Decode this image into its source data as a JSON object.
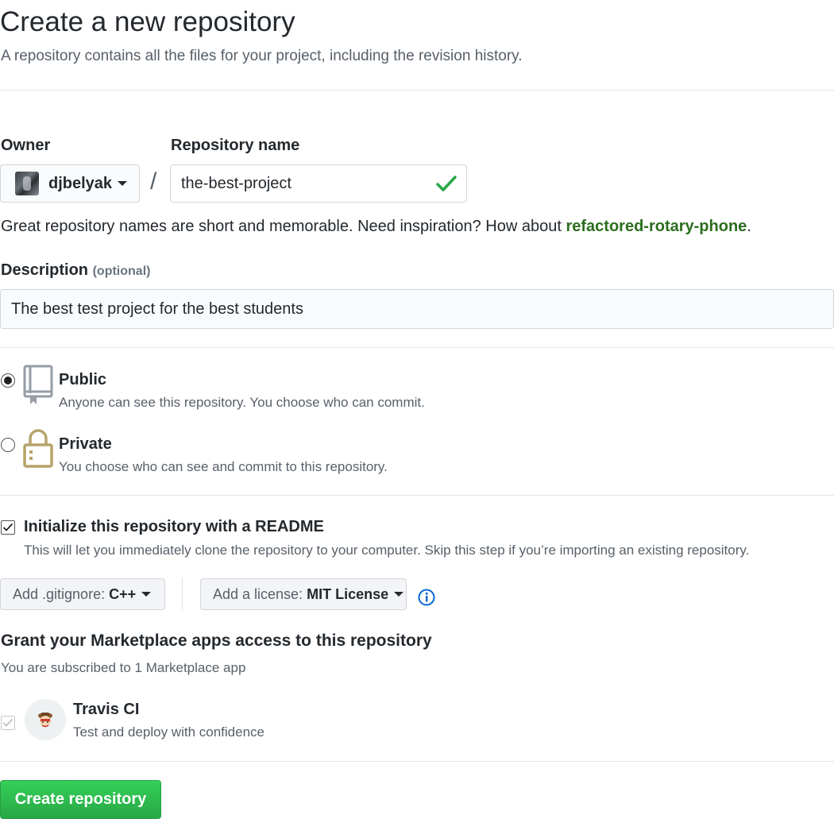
{
  "header": {
    "title": "Create a new repository",
    "subtitle": "A repository contains all the files for your project, including the revision history."
  },
  "owner": {
    "label": "Owner",
    "value": "djbelyak"
  },
  "repo_name": {
    "label": "Repository name",
    "value": "the-best-project",
    "separator": "/"
  },
  "hint": {
    "text": "Great repository names are short and memorable. Need inspiration? How about ",
    "suggestion": "refactored-rotary-phone",
    "end": "."
  },
  "description": {
    "label": "Description",
    "optional": "(optional)",
    "value": "The best test project for the best students"
  },
  "visibility": {
    "selected": "public",
    "public": {
      "title": "Public",
      "desc": "Anyone can see this repository. You choose who can commit."
    },
    "private": {
      "title": "Private",
      "desc": "You choose who can see and commit to this repository."
    }
  },
  "readme": {
    "checked": true,
    "title": "Initialize this repository with a README",
    "desc": "This will let you immediately clone the repository to your computer. Skip this step if you’re importing an existing repository."
  },
  "gitignore": {
    "label": "Add .gitignore:",
    "value": "C++"
  },
  "license": {
    "label": "Add a license:",
    "value": "MIT License"
  },
  "marketplace": {
    "heading": "Grant your Marketplace apps access to this repository",
    "note": "You are subscribed to 1 Marketplace app",
    "apps": [
      {
        "name": "Travis CI",
        "desc": "Test and deploy with confidence",
        "checked": true
      }
    ]
  },
  "submit": {
    "label": "Create repository"
  },
  "colors": {
    "accent_green": "#28a745",
    "suggestion_green": "#2c6e1f",
    "info_blue": "#0366d6",
    "lock_gold": "#b5a36a"
  }
}
